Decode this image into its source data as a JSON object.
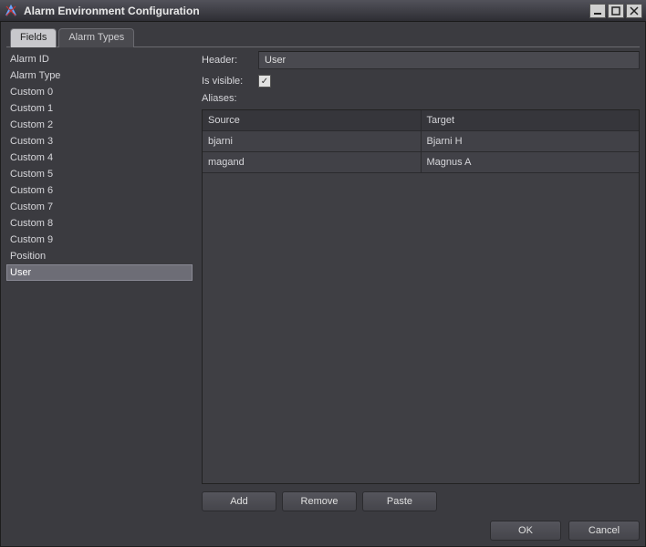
{
  "titlebar": {
    "title": "Alarm Environment Configuration"
  },
  "tabs": [
    {
      "label": "Fields",
      "active": true
    },
    {
      "label": "Alarm Types",
      "active": false
    }
  ],
  "fields_list": [
    "Alarm ID",
    "Alarm Type",
    "Custom 0",
    "Custom 1",
    "Custom 2",
    "Custom 3",
    "Custom 4",
    "Custom 5",
    "Custom 6",
    "Custom 7",
    "Custom 8",
    "Custom 9",
    "Position",
    "User"
  ],
  "selected_field_index": 13,
  "form": {
    "header_label": "Header:",
    "header_value": "User",
    "is_visible_label": "Is visible:",
    "is_visible_checked": true,
    "aliases_label": "Aliases:"
  },
  "aliases": {
    "columns": [
      "Source",
      "Target"
    ],
    "rows": [
      {
        "source": "bjarni",
        "target": "Bjarni H"
      },
      {
        "source": "magand",
        "target": "Magnus A"
      }
    ]
  },
  "buttons": {
    "add": "Add",
    "remove": "Remove",
    "paste": "Paste",
    "ok": "OK",
    "cancel": "Cancel"
  }
}
